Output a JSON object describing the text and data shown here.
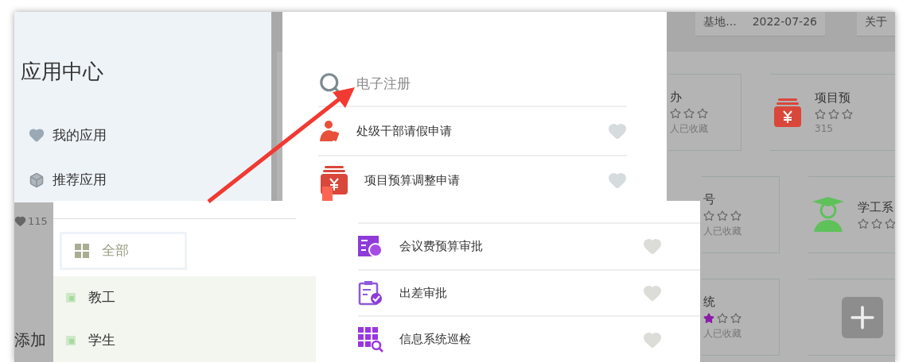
{
  "notices": [
    {
      "title": "基地...",
      "date": "2022-07-26"
    },
    {
      "title": "关于"
    }
  ],
  "background": {
    "count": "115",
    "section_title": "添加"
  },
  "cards": [
    {
      "kind": "app",
      "title": "办",
      "stars": 0,
      "caption": "人已收藏"
    },
    {
      "kind": "app",
      "title": "项目预",
      "stars": 0,
      "caption": "315"
    },
    {
      "kind": "app",
      "title": "号",
      "stars": 0,
      "caption": "人已收藏"
    },
    {
      "kind": "app",
      "title": "学工系",
      "stars": 0
    },
    {
      "kind": "app",
      "title": "统",
      "stars": 1,
      "caption": "人已收藏"
    },
    {
      "kind": "add"
    }
  ],
  "sidebar": {
    "title": "应用中心",
    "items": [
      {
        "label": "我的应用"
      },
      {
        "label": "推荐应用"
      }
    ]
  },
  "search": {
    "value": "电子注册",
    "results": [
      {
        "name": "处级干部请假申请"
      },
      {
        "name": "项目预算调整申请"
      }
    ]
  },
  "categories": [
    {
      "label": "全部",
      "selected": true
    },
    {
      "label": "教工",
      "selected": false
    },
    {
      "label": "学生",
      "selected": false
    }
  ],
  "results": [
    {
      "name": "会议费预算审批"
    },
    {
      "name": "出差审批"
    },
    {
      "name": "信息系统巡检"
    }
  ]
}
